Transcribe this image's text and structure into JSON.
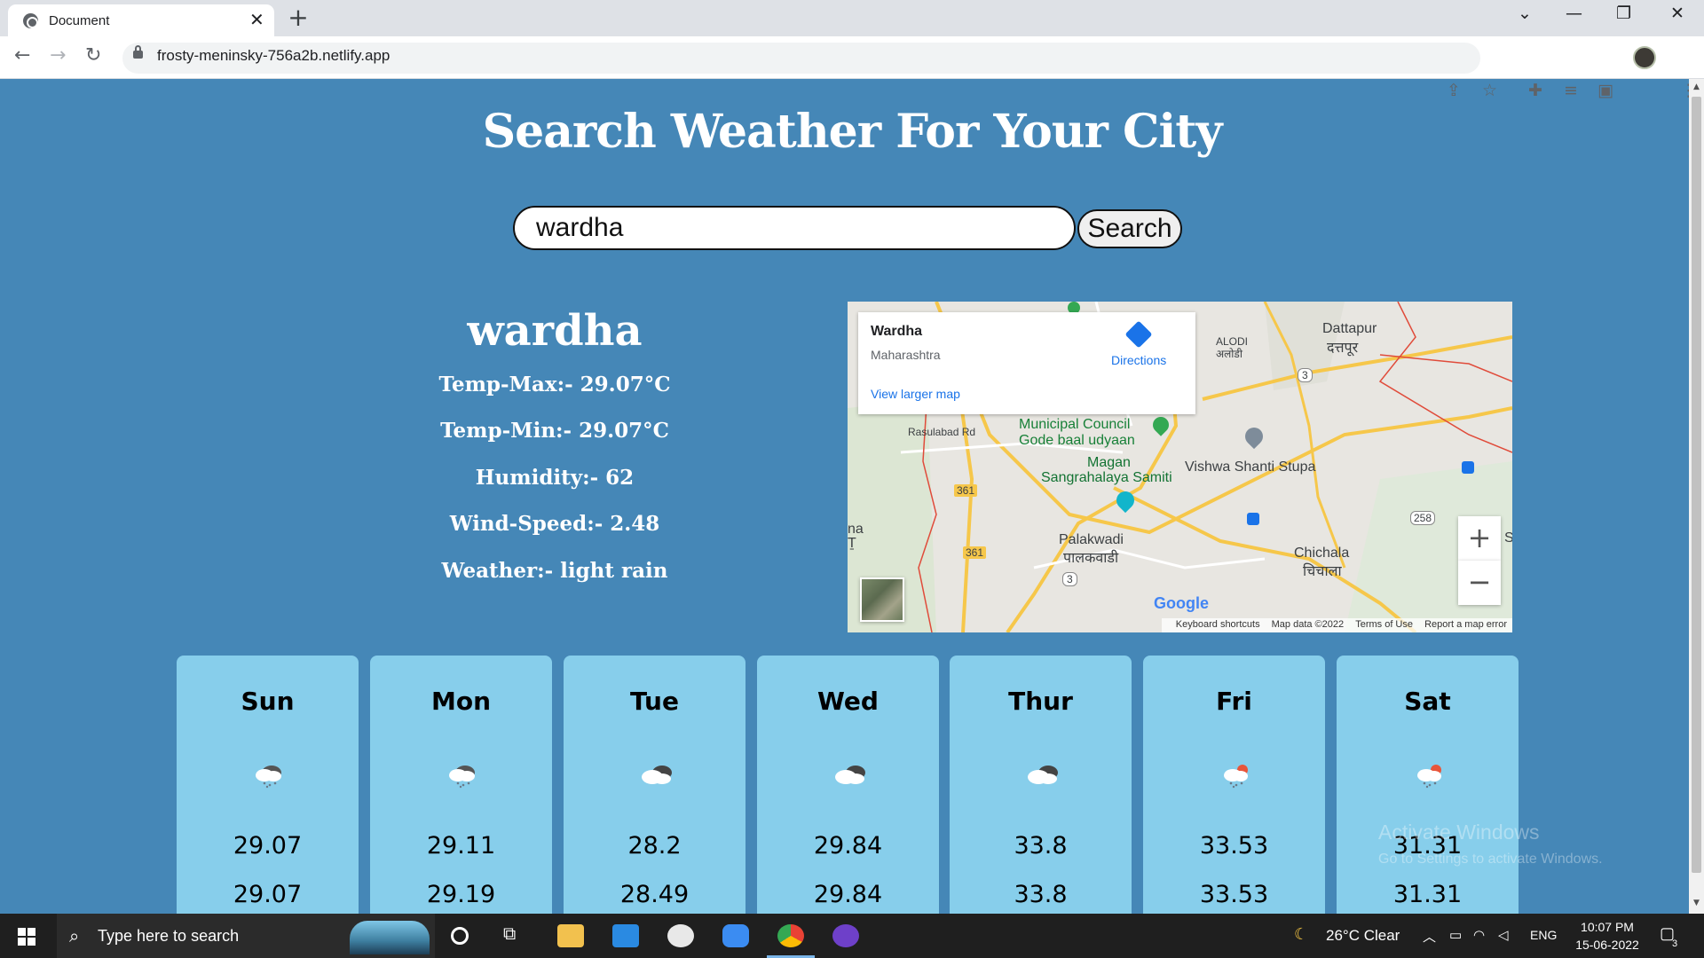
{
  "browser": {
    "tab_title": "Document",
    "tab_close": "✕",
    "new_tab": "+",
    "url": "frosty-meninsky-756a2b.netlify.app",
    "window_controls": [
      "⌄",
      "—",
      "❐",
      "✕"
    ],
    "nav": {
      "back": "←",
      "forward": "→",
      "reload": "↻"
    }
  },
  "page": {
    "title": "Search Weather For Your City",
    "search_value": "wardha",
    "search_button": "Search",
    "city": "wardha",
    "stats": [
      "Temp-Max:- 29.07°C",
      "Temp-Min:- 29.07°C",
      "Humidity:- 62",
      "Wind-Speed:- 2.48",
      "Weather:- light rain"
    ]
  },
  "map": {
    "place": "Wardha",
    "region": "Maharashtra",
    "directions": "Directions",
    "view_larger": "View larger map",
    "labels": {
      "dattapur": "Dattapur",
      "dattapur_hi": "दत्तपूर",
      "alodi": "ALODI",
      "alodi_hi": "अलोडी",
      "rasulabad": "Rasulabad Rd",
      "municipal1": "Municipal Council",
      "municipal2": "Gode baal udyaan",
      "magan1": "Magan",
      "magan2": "Sangrahalaya Samiti",
      "vishwa": "Vishwa Shanti Stupa",
      "palakwadi": "Palakwadi",
      "palakwadi_hi": "पालकवाडी",
      "chichala": "Chichala",
      "chichala_hi": "चिचाला",
      "na": "na",
      "na2": "Ṯ",
      "s": "S",
      "road_361a": "361",
      "road_361b": "361",
      "road_3a": "3",
      "road_3b": "3",
      "road_258": "258"
    },
    "google": "Google",
    "footer": [
      "Keyboard shortcuts",
      "Map data ©2022",
      "Terms of Use",
      "Report a map error"
    ],
    "zoom_in": "+",
    "zoom_out": "−"
  },
  "forecast": [
    {
      "day": "Sun",
      "icon": "rain-cloud-icon",
      "max": "29.07",
      "min": "29.07"
    },
    {
      "day": "Mon",
      "icon": "rain-cloud-icon",
      "max": "29.11",
      "min": "29.19"
    },
    {
      "day": "Tue",
      "icon": "cloudy-icon",
      "max": "28.2",
      "min": "28.49"
    },
    {
      "day": "Wed",
      "icon": "cloudy-icon",
      "max": "29.84",
      "min": "29.84"
    },
    {
      "day": "Thur",
      "icon": "cloudy-icon",
      "max": "33.8",
      "min": "33.8"
    },
    {
      "day": "Fri",
      "icon": "sun-rain-icon",
      "max": "33.53",
      "min": "33.53"
    },
    {
      "day": "Sat",
      "icon": "sun-rain-icon",
      "max": "31.31",
      "min": "31.31"
    }
  ],
  "watermark": {
    "line1": "Activate Windows",
    "line2": "Go to Settings to activate Windows."
  },
  "taskbar": {
    "search_placeholder": "Type here to search",
    "weather": "26°C  Clear",
    "language": "ENG",
    "time": "10:07 PM",
    "date": "15-06-2022",
    "notifications": "3"
  },
  "colors": {
    "page_bg": "#4587b7",
    "card_bg": "#87ceeb",
    "accent": "#1a73e8"
  }
}
